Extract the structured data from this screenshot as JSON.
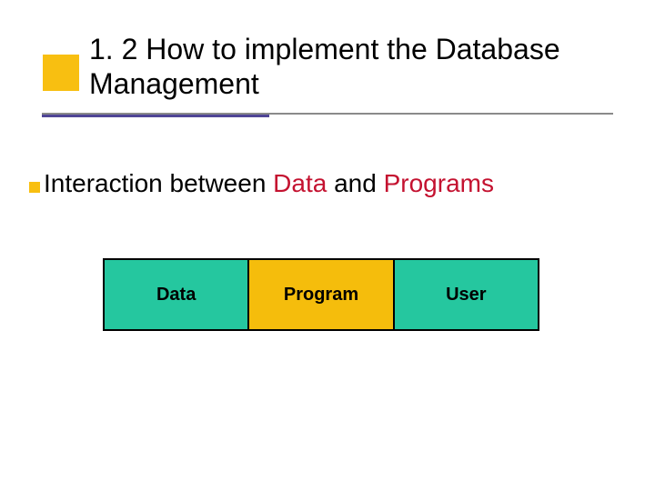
{
  "title": "1. 2 How to implement the Database Management",
  "body": {
    "prefix": "Interaction between ",
    "data": "Data",
    "mid": " and ",
    "programs": "Programs"
  },
  "boxes": {
    "data": "Data",
    "program": "Program",
    "user": "User"
  },
  "colors": {
    "accent_yellow": "#f8bf11",
    "line_gray": "#8a8a8a",
    "line_purple": "#4f4596",
    "highlight_red": "#c41230",
    "box_green": "#25c79f",
    "box_yellow": "#f5bd0c"
  }
}
